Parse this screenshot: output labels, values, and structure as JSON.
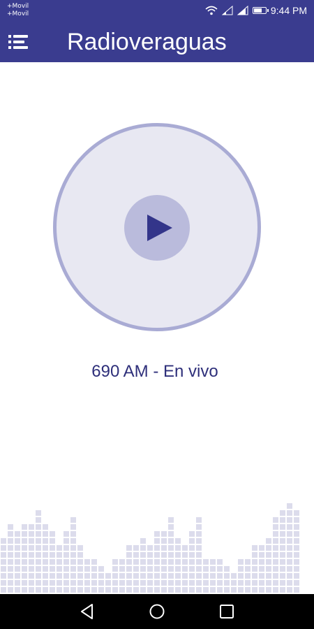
{
  "status_bar": {
    "carrier_1": "+Movil",
    "carrier_2": "+Movil",
    "time": "9:44 PM"
  },
  "app_bar": {
    "title": "Radioveraguas"
  },
  "player": {
    "station_label": "690 AM - En vivo"
  },
  "icons": {
    "menu": "menu-icon",
    "play": "play-icon",
    "wifi": "wifi-icon",
    "signal": "signal-icon",
    "battery": "battery-icon",
    "back": "back-icon",
    "home": "home-icon",
    "recents": "recents-icon"
  },
  "colors": {
    "primary": "#3a3c8f",
    "circle_fill": "#e8e8f2",
    "circle_ring": "#a9abd4",
    "play_bg": "#babbdc",
    "play_triangle": "#33358a",
    "station_text": "#2e2f7a",
    "visualizer": "#dcdcec"
  }
}
